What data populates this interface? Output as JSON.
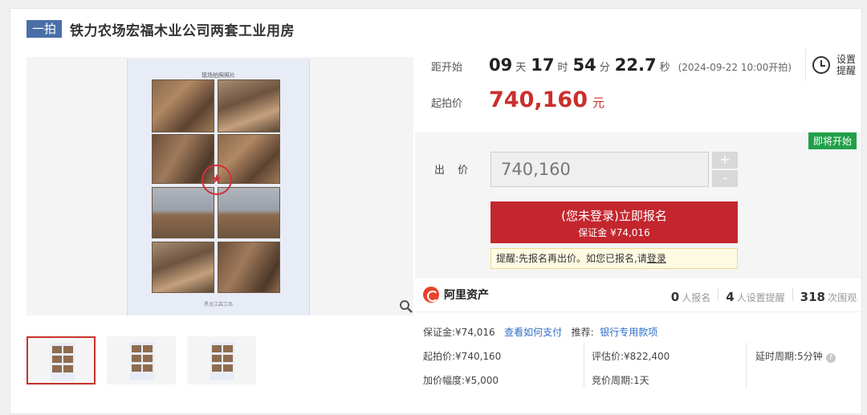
{
  "title": {
    "badge": "一拍",
    "text": "铁力农场宏福木业公司两套工业用房"
  },
  "image": {
    "paper_caption": "现场拍照照片",
    "paper_footer": "黑龙江森工局"
  },
  "countdown": {
    "label": "距开始",
    "days": "09",
    "days_unit": "天",
    "hours": "17",
    "hours_unit": "时",
    "minutes": "54",
    "minutes_unit": "分",
    "seconds": "22.7",
    "seconds_unit": "秒",
    "note": "(2024-09-22 10:00开拍)"
  },
  "reminder": {
    "label": "设置提醒"
  },
  "start_price": {
    "label": "起拍价",
    "value": "740,160",
    "unit": "元"
  },
  "bid": {
    "status_tag": "即将开始",
    "label": "出 价",
    "input_value": "740,160",
    "plus": "+",
    "minus": "-",
    "register_main": "(您未登录)立即报名",
    "register_sub": "保证金 ¥74,016",
    "tip_prefix": "提醒:先报名再出价。如您已报名,请",
    "tip_link": "登录"
  },
  "platform": {
    "name": "阿里资产",
    "registered_count": "0",
    "registered_label": "人报名",
    "reminders_count": "4",
    "reminders_label": "人设置提醒",
    "watchers_count": "318",
    "watchers_label": "次围观"
  },
  "details": {
    "deposit": "保证金:¥74,016",
    "how_to_pay": "查看如何支付",
    "recommend_label": "推荐:",
    "recommend_link": "银行专用款项",
    "start_price": "起拍价:¥740,160",
    "appraisal": "评估价:¥822,400",
    "delay": "延时周期:5分钟",
    "increment": "加价幅度:¥5,000",
    "bid_period": "竞价周期:1天"
  },
  "colors": {
    "accent_red": "#c9302c",
    "badge_blue": "#4a6ea8",
    "status_green": "#22a049",
    "link_blue": "#2d6ec7"
  }
}
